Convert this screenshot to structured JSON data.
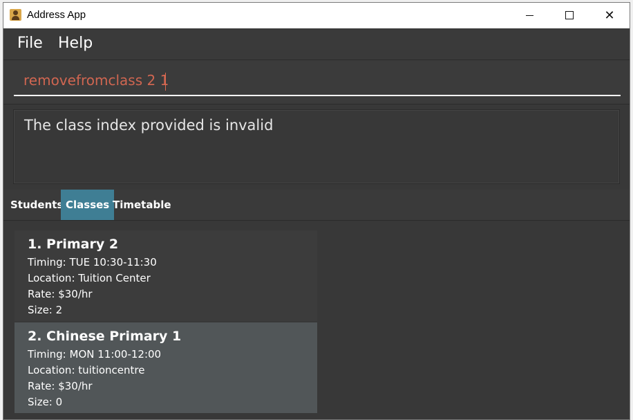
{
  "window": {
    "title": "Address App",
    "controls": {
      "minimize": "minimize",
      "maximize": "maximize",
      "close": "close"
    }
  },
  "menu": {
    "file": "File",
    "help": "Help"
  },
  "command": {
    "value": "removefromclass 2 1",
    "text_color": "#d06651"
  },
  "result": {
    "message": "The class index provided is invalid"
  },
  "tabs": [
    {
      "label": "Students",
      "active": false
    },
    {
      "label": "Classes",
      "active": true
    },
    {
      "label": "Timetable",
      "active": false
    }
  ],
  "classes": [
    {
      "title": "1.  Primary 2",
      "timing": "Timing: TUE 10:30-11:30",
      "location": "Location: Tuition Center",
      "rate": "Rate: $30/hr",
      "size": "Size: 2"
    },
    {
      "title": "2.  Chinese Primary 1",
      "timing": "Timing: MON 11:00-12:00",
      "location": "Location: tuitioncentre",
      "rate": "Rate: $30/hr",
      "size": "Size: 0"
    }
  ],
  "colors": {
    "accent": "#3f7e94",
    "background": "#383838",
    "selected_card": "#515658"
  }
}
